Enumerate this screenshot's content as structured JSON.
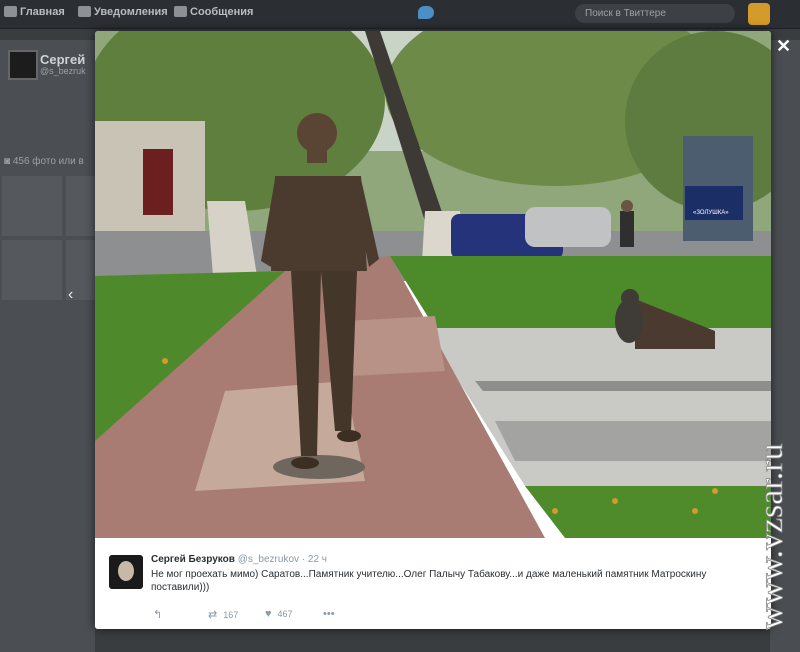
{
  "topnav": {
    "home_label": "Главная",
    "notifications_label": "Уведомления",
    "messages_label": "Сообщения",
    "search_placeholder": "Поиск в Твиттере"
  },
  "background_profile": {
    "name": "Сергей",
    "handle": "@s_bezruk",
    "photos_label": "456 фото или в"
  },
  "tweet": {
    "author_name": "Сергей Безруков",
    "author_handle": "@s_bezrukov",
    "time": "· 22 ч",
    "text": "Не мог проехать мимо) Саратов...Памятник учителю...Олег Палычу Табакову...и даже маленький памятник Матроскину поставили)))",
    "retweets": "167",
    "likes": "467"
  },
  "photo": {
    "poster_text": "«ЗОЛУШКА»"
  },
  "watermark": "www.vzsar.ru",
  "icons": [
    "home-icon",
    "bell-icon",
    "envelope-icon",
    "twitter-bird-icon",
    "close-icon",
    "reply-icon",
    "retweet-icon",
    "heart-icon",
    "more-icon",
    "camera-icon",
    "chevron-left-icon"
  ]
}
